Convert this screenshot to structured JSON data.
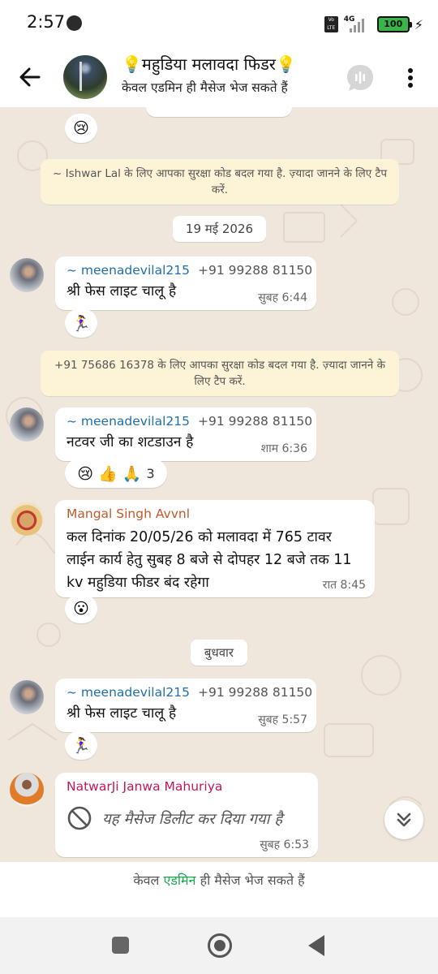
{
  "status_bar": {
    "time": "2:57",
    "battery": "100",
    "network": "4G",
    "volte": "Vo LTE"
  },
  "header": {
    "title": "💡महुडिया मलावदा फिडर💡",
    "subtitle": "केवल एडमिन ही मैसेज भेज सकते हैं"
  },
  "chat": {
    "top_reaction": "😢",
    "system_note_1": "~ Ishwar Lal के लिए आपका सुरक्षा कोड बदल गया है. ज़्यादा जानने के लिए टैप करें.",
    "date_1": "19 मई 2026",
    "messages": [
      {
        "sender": "~ meenadevilal215",
        "phone": "+91 99288 81150",
        "text": "श्री फेस लाइट चालू है",
        "time": "सुबह 6:44",
        "reaction": "🏃‍♀️"
      },
      {
        "sender": "~ meenadevilal215",
        "phone": "+91 99288 81150",
        "text": "नटवर जी का शटडाउन है",
        "time": "शाम 6:36",
        "reactions": "😢 👍 🙏",
        "reaction_count": "3"
      },
      {
        "sender": "Mangal Singh Avvnl",
        "text_lines": [
          "कल दिनांक 20/05/26 को मलावदा में 765 टावर",
          "लाईन कार्य हेतु सुबह 8 बजे से दोपहर 12 बजे तक 11",
          "kv महुडिया फीडर बंद रहेगा"
        ],
        "time": "रात 8:45",
        "reaction": "😮"
      },
      {
        "sender": "~ meenadevilal215",
        "phone": "+91 99288 81150",
        "text": "श्री फेस लाइट चालू है",
        "time": "सुबह 5:57",
        "reaction": "🏃‍♀️"
      },
      {
        "sender": "NatwarJi Janwa Mahuriya",
        "text": "यह मैसेज डिलीट कर दिया गया है",
        "time": "सुबह 6:53"
      }
    ],
    "system_note_2": "+91 75686 16378 के लिए आपका सुरक्षा कोड बदल गया है. ज़्यादा जानने के लिए टैप करें.",
    "date_2": "बुधवार"
  },
  "footer": {
    "prefix": "केवल ",
    "admin": "एडमिन",
    "suffix": " ही मैसेज भेज सकते हैं"
  },
  "icons": {
    "back": "arrow-left-icon",
    "call": "voice-chat-icon",
    "menu": "more-vert-icon",
    "deleted": "block-icon",
    "scroll": "double-chevron-down-icon"
  }
}
